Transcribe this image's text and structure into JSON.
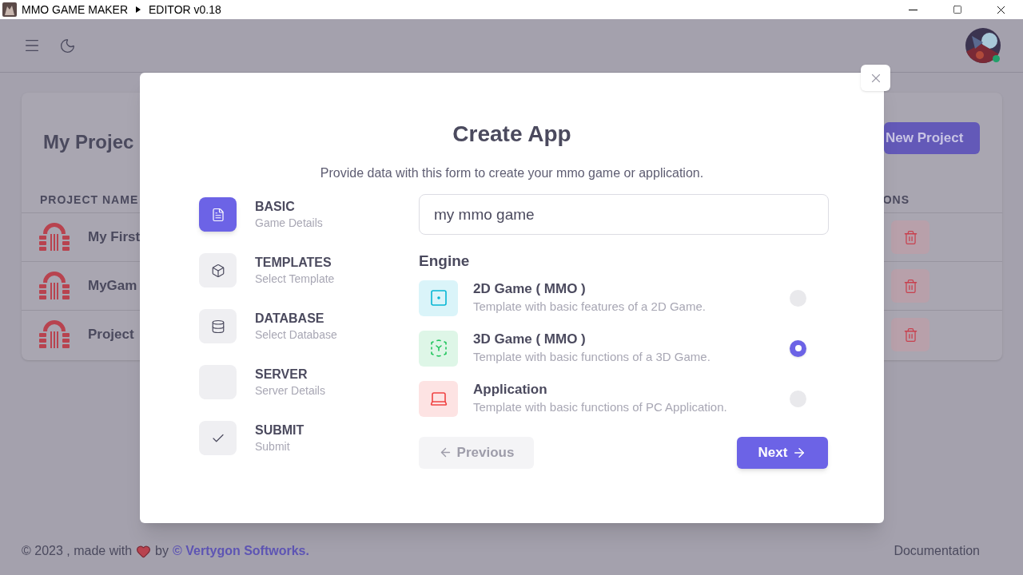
{
  "title_bar": {
    "app": "MMO GAME MAKER",
    "section": "EDITOR v0.18"
  },
  "page": {
    "title": "My Projec",
    "new_project": "New Project",
    "column_1": "PROJECT NAME",
    "column_last": "ONS",
    "rows": [
      {
        "name": "My First"
      },
      {
        "name": "MyGam"
      },
      {
        "name": "Project"
      }
    ]
  },
  "dialog": {
    "title": "Create App",
    "subtitle": "Provide data with this form to create your mmo game or application.",
    "steps": [
      {
        "title": "BASIC",
        "subtitle": "Game Details",
        "selected": true
      },
      {
        "title": "TEMPLATES",
        "subtitle": "Select Template",
        "selected": false
      },
      {
        "title": "DATABASE",
        "subtitle": "Select Database",
        "selected": false
      },
      {
        "title": "SERVER",
        "subtitle": "Server Details",
        "selected": false
      },
      {
        "title": "SUBMIT",
        "subtitle": "Submit",
        "selected": false
      }
    ],
    "name_value": "my mmo game",
    "engine_label": "Engine",
    "options": [
      {
        "title": "2D Game ( MMO )",
        "description": "Template with basic features of a 2D Game.",
        "color": "#06b6d4",
        "selected": false
      },
      {
        "title": "3D Game ( MMO )",
        "description": "Template with basic functions of a 3D Game.",
        "color": "#22c55e",
        "selected": true
      },
      {
        "title": "Application",
        "description": "Template with basic functions of PC Application.",
        "color": "#ef4444",
        "selected": false
      }
    ],
    "previous": {
      "label": "Previous",
      "disabled": true
    },
    "next": {
      "label": "Next",
      "disabled": false
    }
  },
  "footer": {
    "prefix": "© 2023 , made with",
    "by": "by",
    "link": "© Vertygon Softworks.",
    "documentation": "Documentation"
  }
}
